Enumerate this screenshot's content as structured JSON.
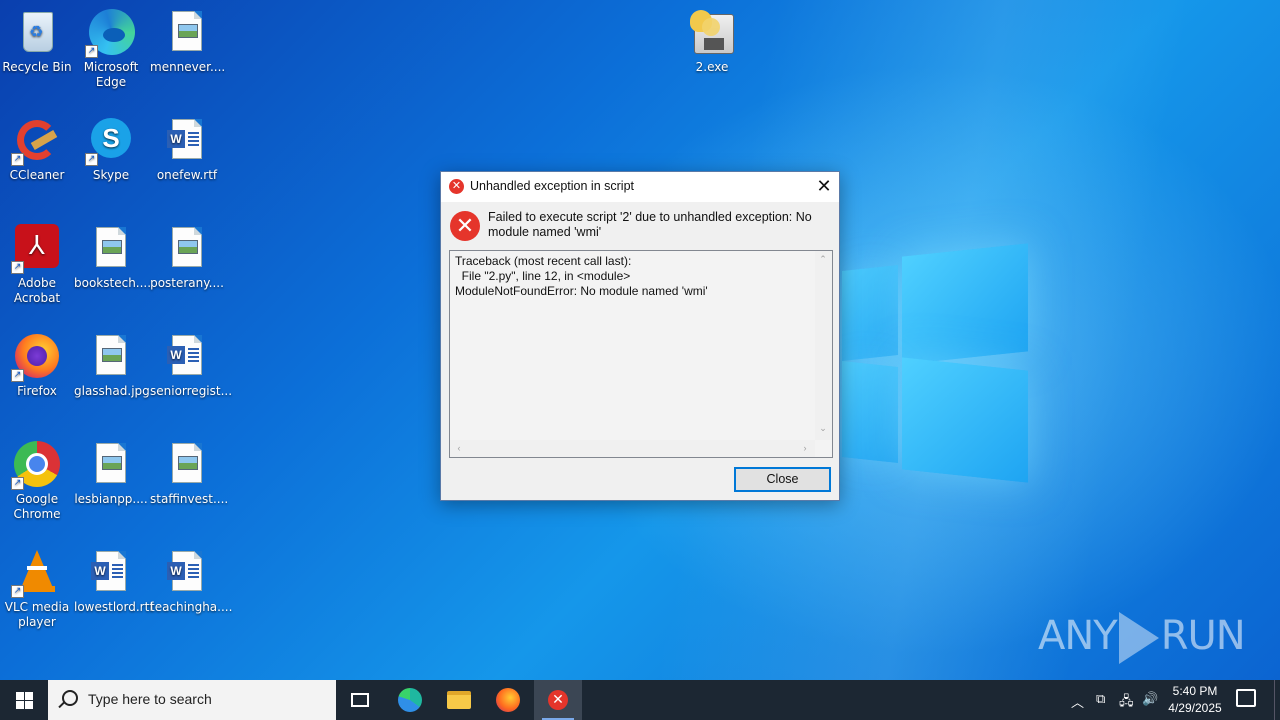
{
  "desktop": {
    "icons": [
      {
        "label": "Recycle Bin",
        "icon": "recycle-bin-icon"
      },
      {
        "label": "Microsoft Edge",
        "icon": "edge-icon"
      },
      {
        "label": "mennever....",
        "icon": "image-file-icon"
      },
      {
        "label": "CCleaner",
        "icon": "ccleaner-icon"
      },
      {
        "label": "Skype",
        "icon": "skype-icon"
      },
      {
        "label": "onefew.rtf",
        "icon": "word-doc-icon"
      },
      {
        "label": "Adobe Acrobat",
        "icon": "acrobat-icon"
      },
      {
        "label": "bookstech....",
        "icon": "image-file-icon"
      },
      {
        "label": "posterany....",
        "icon": "image-file-icon"
      },
      {
        "label": "Firefox",
        "icon": "firefox-icon"
      },
      {
        "label": "glasshad.jpg",
        "icon": "image-file-icon"
      },
      {
        "label": "seniorregist...",
        "icon": "word-doc-icon"
      },
      {
        "label": "Google Chrome",
        "icon": "chrome-icon"
      },
      {
        "label": "lesbianpp....",
        "icon": "image-file-icon"
      },
      {
        "label": "staffinvest....",
        "icon": "image-file-icon"
      },
      {
        "label": "VLC media player",
        "icon": "vlc-icon"
      },
      {
        "label": "lowestlord.rtf",
        "icon": "word-doc-icon"
      },
      {
        "label": "teachingha....",
        "icon": "word-doc-icon"
      },
      {
        "label": "2.exe",
        "icon": "python-exe-icon"
      }
    ]
  },
  "dialog": {
    "title": "Unhandled exception in script",
    "message": "Failed to execute script '2' due to unhandled exception: No module named 'wmi'",
    "traceback": "Traceback (most recent call last):\n  File \"2.py\", line 12, in <module>\nModuleNotFoundError: No module named 'wmi'",
    "close_button": "Close",
    "close_glyph": "✕"
  },
  "watermark": {
    "left": "ANY",
    "right": "RUN"
  },
  "taskbar": {
    "search_placeholder": "Type here to search",
    "time": "5:40 PM",
    "date": "4/29/2025"
  },
  "colors": {
    "dialog_border": "#0078d7",
    "error_red": "#e5352b",
    "taskbar": "#1c2733"
  }
}
